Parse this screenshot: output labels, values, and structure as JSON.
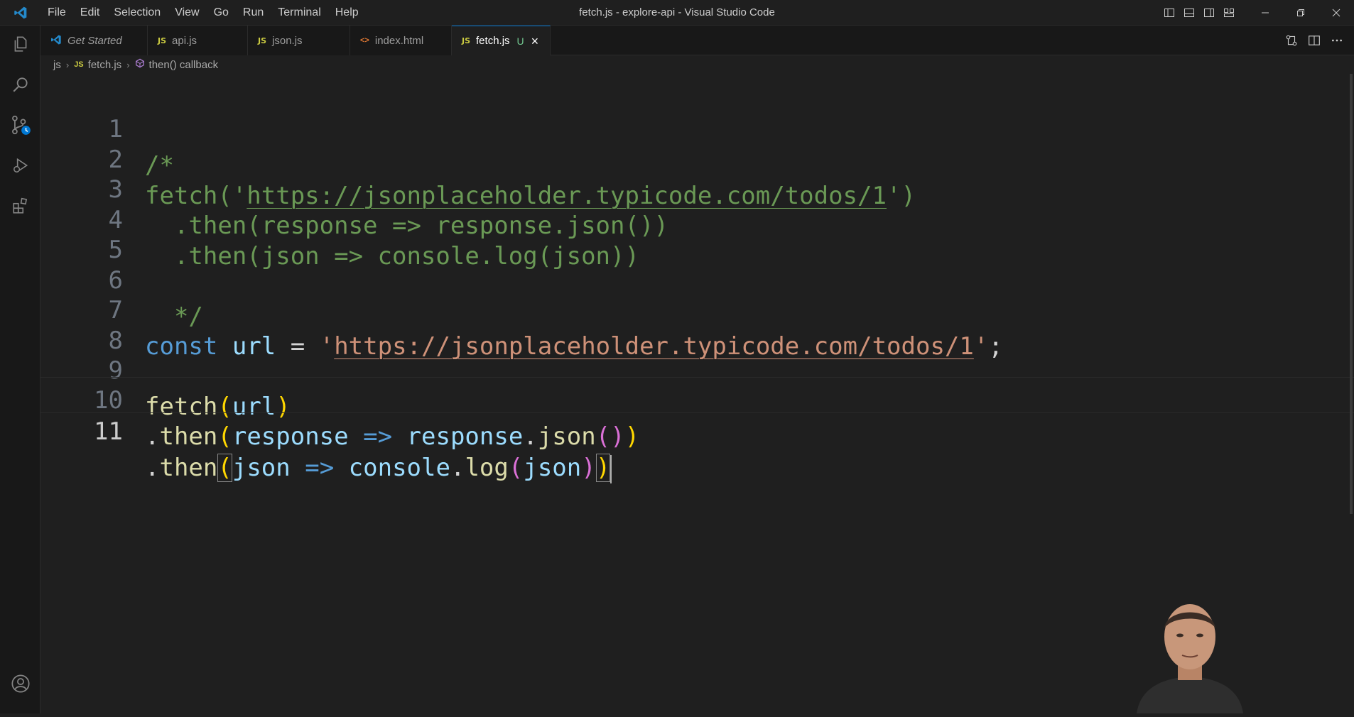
{
  "window": {
    "title": "fetch.js - explore-api - Visual Studio Code",
    "menu": [
      "File",
      "Edit",
      "Selection",
      "View",
      "Go",
      "Run",
      "Terminal",
      "Help"
    ]
  },
  "activity_bar": {
    "icons": [
      "explorer-icon",
      "search-icon",
      "source-control-icon",
      "run-debug-icon",
      "extensions-icon",
      "account-icon"
    ]
  },
  "tabs": [
    {
      "label": "Get Started",
      "icon": "vscode-icon",
      "active": false
    },
    {
      "label": "api.js",
      "icon": "JS",
      "active": false
    },
    {
      "label": "json.js",
      "icon": "JS",
      "active": false
    },
    {
      "label": "index.html",
      "icon": "<>",
      "active": false
    },
    {
      "label": "fetch.js",
      "icon": "JS",
      "active": true,
      "status": "U"
    }
  ],
  "breadcrumb": {
    "folder": "js",
    "file_icon": "JS",
    "file": "fetch.js",
    "symbol": "then() callback"
  },
  "editor": {
    "language": "javascript",
    "current_line": 11,
    "lines": [
      {
        "n": "1",
        "text": "/*"
      },
      {
        "n": "2",
        "text": "fetch('https://jsonplaceholder.typicode.com/todos/1')"
      },
      {
        "n": "3",
        "text": "  .then(response => response.json())"
      },
      {
        "n": "4",
        "text": "  .then(json => console.log(json))"
      },
      {
        "n": "5",
        "text": ""
      },
      {
        "n": "6",
        "text": "  */"
      },
      {
        "n": "7",
        "text": "const url = 'https://jsonplaceholder.typicode.com/todos/1';"
      },
      {
        "n": "8",
        "text": ""
      },
      {
        "n": "9",
        "text": "fetch(url)"
      },
      {
        "n": "10",
        "text": ".then(response => response.json())"
      },
      {
        "n": "11",
        "text": ".then(json => console.log(json))"
      }
    ]
  },
  "tokens": {
    "l1": "/*",
    "l2a": "fetch('",
    "l2url": "https://jsonplaceholder.typicode.com/todos/1",
    "l2b": "')",
    "l3": "  .then(response => response.json())",
    "l4": "  .then(json => console.log(json))",
    "l6": "  */",
    "l7_const": "const",
    "l7_url": "url",
    "l7_eq": "=",
    "l7_q1": "'",
    "l7_str": "https://jsonplaceholder.typicode.com/todos/1",
    "l7_q2": "'",
    "l7_semi": ";",
    "l9_fetch": "fetch",
    "l9_url": "url",
    "l10_dot": ".",
    "l10_then": "then",
    "l10_resp": "response",
    "l10_arrow": "=>",
    "l10_resp2": "response",
    "l10_json": "json",
    "l11_dot": ".",
    "l11_then": "then",
    "l11_json": "json",
    "l11_arrow": "=>",
    "l11_console": "console",
    "l11_log": "log",
    "l11_json2": "json"
  },
  "colors": {
    "background": "#1f1f1f",
    "comment": "#6a9955",
    "keyword": "#569cd6",
    "variable": "#9cdcfe",
    "function": "#dcdcaa",
    "string": "#ce9178",
    "bracket_1": "#ffd700",
    "bracket_2": "#da70d6",
    "accent": "#0078d4"
  }
}
